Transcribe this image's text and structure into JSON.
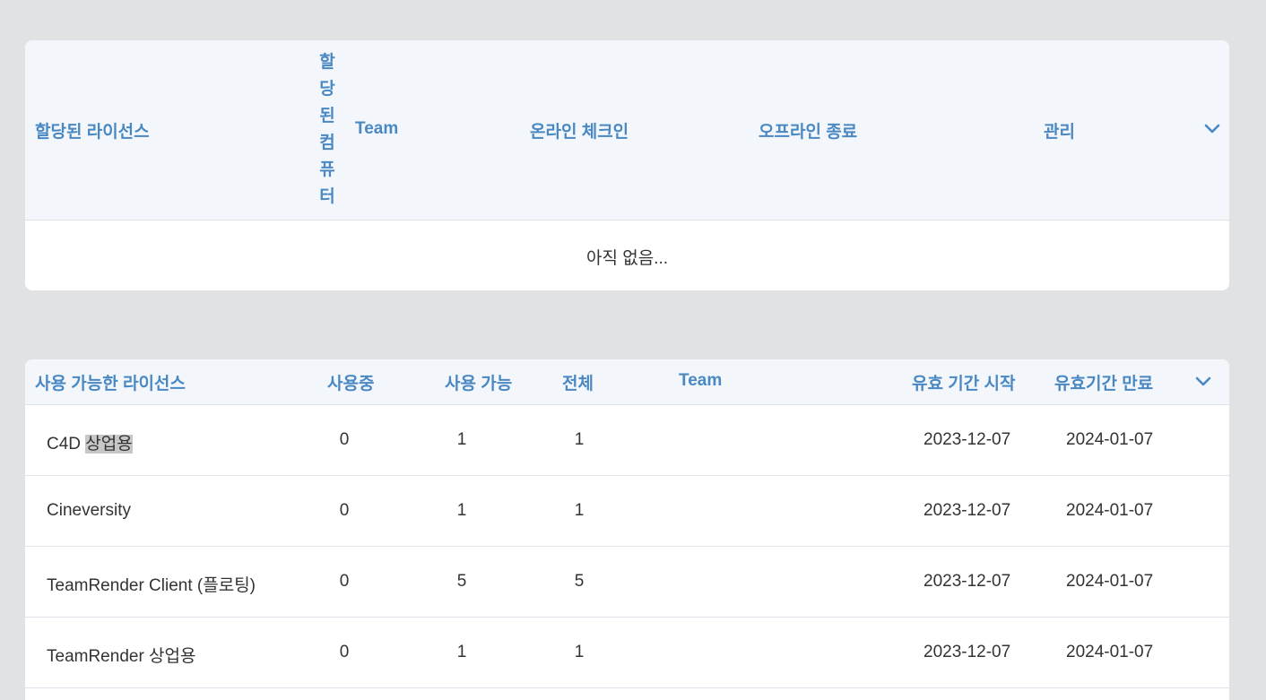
{
  "assigned_table": {
    "headers": {
      "license": "할당된 라이선스",
      "computer": "할당된컴퓨터",
      "team": "Team",
      "online_checkin": "온라인 체크인",
      "offline_end": "오프라인 종료",
      "manage": "관리"
    },
    "empty_text": "아직 없음..."
  },
  "available_table": {
    "headers": {
      "license": "사용 가능한 라이선스",
      "in_use": "사용중",
      "available": "사용 가능",
      "total": "전체",
      "team": "Team",
      "start": "유효 기간 시작",
      "end": "유효기간 만료"
    },
    "rows": [
      {
        "name_a": "C4D ",
        "name_b": "상업용",
        "in_use": "0",
        "available": "1",
        "total": "1",
        "team": "",
        "start": "2023-12-07",
        "end": "2024-01-07"
      },
      {
        "name_a": "Cineversity",
        "name_b": "",
        "in_use": "0",
        "available": "1",
        "total": "1",
        "team": "",
        "start": "2023-12-07",
        "end": "2024-01-07"
      },
      {
        "name_a": "TeamRender Client (플로팅)",
        "name_b": "",
        "in_use": "0",
        "available": "5",
        "total": "5",
        "team": "",
        "start": "2023-12-07",
        "end": "2024-01-07"
      },
      {
        "name_a": "TeamRender 상업용",
        "name_b": "",
        "in_use": "0",
        "available": "1",
        "total": "1",
        "team": "",
        "start": "2023-12-07",
        "end": "2024-01-07"
      }
    ]
  },
  "icons": {
    "expand": "chevron-down-icon"
  },
  "colors": {
    "background": "#e1e2e4",
    "header_bg": "#f3f7fc",
    "header_text": "#4a88c2",
    "body_text": "#333333",
    "highlight": "#c7c7c7"
  }
}
